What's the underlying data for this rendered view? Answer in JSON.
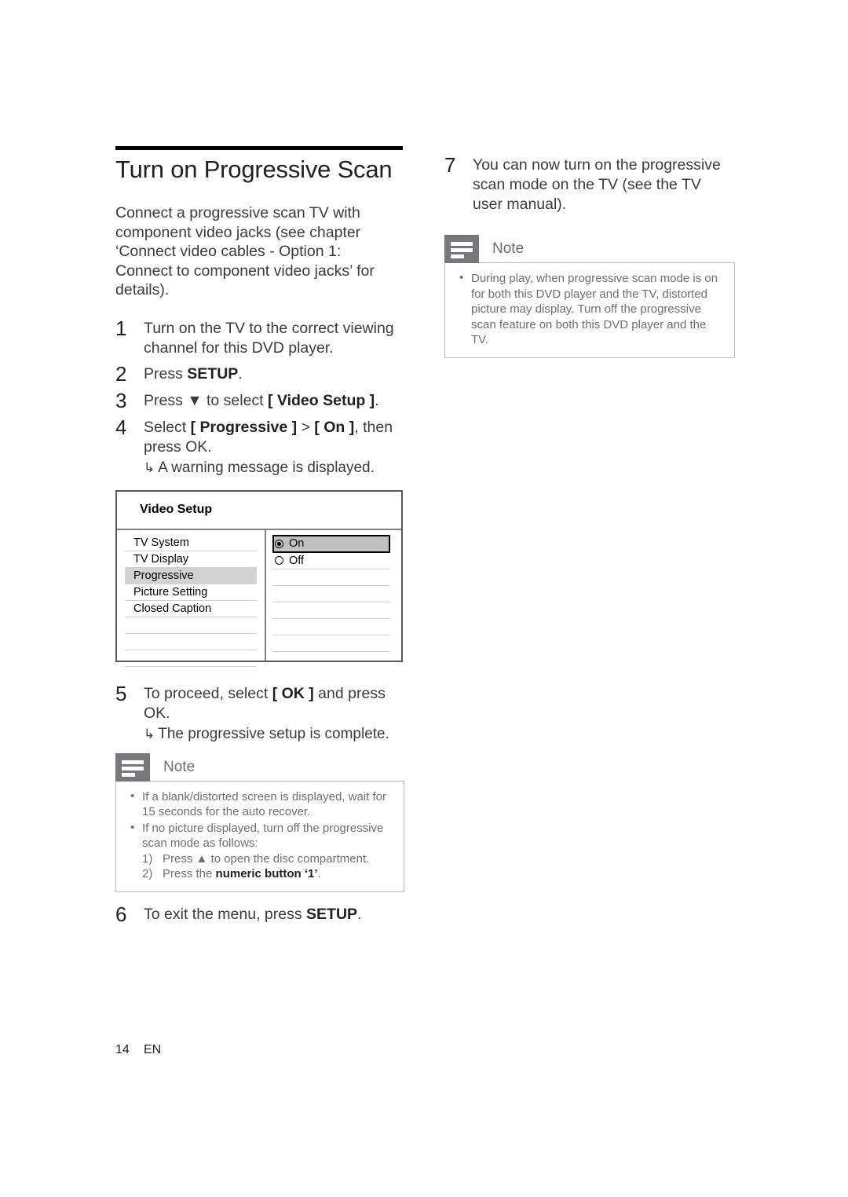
{
  "document": {
    "title": "Turn on Progressive Scan",
    "intro": "Connect a progressive scan TV with component video jacks (see chapter ‘Connect video cables - Option 1: Connect to component video jacks’ for details).",
    "footer": {
      "page_number": "14",
      "language": "EN"
    }
  },
  "steps": {
    "s1": {
      "num": "1",
      "text": "Turn on the TV to the correct viewing channel for this DVD player."
    },
    "s2": {
      "num": "2",
      "pre": "Press ",
      "bold": "SETUP",
      "post": "."
    },
    "s3": {
      "num": "3",
      "pre": "Press ▼ to select ",
      "bold": "[ Video Setup ]",
      "post": "."
    },
    "s4": {
      "num": "4",
      "pre": "Select ",
      "bold1": "[ Progressive ]",
      "mid": " > ",
      "bold2": "[ On ]",
      "post": ", then press OK.",
      "result": "A warning message is displayed.",
      "arrow": "↳"
    },
    "s5": {
      "num": "5",
      "pre": "To proceed, select ",
      "bold": "[ OK ]",
      "post": " and press OK.",
      "result": "The progressive setup is complete.",
      "arrow": "↳"
    },
    "s6": {
      "num": "6",
      "pre": "To exit the menu, press ",
      "bold": "SETUP",
      "post": "."
    },
    "s7": {
      "num": "7",
      "text": "You can now turn on the progressive scan mode on the TV (see the TV user manual)."
    }
  },
  "menu_screen": {
    "header": "Video Setup",
    "left_items": [
      {
        "label": "TV System",
        "selected": false
      },
      {
        "label": "TV Display",
        "selected": false
      },
      {
        "label": "Progressive",
        "selected": true
      },
      {
        "label": "Picture Setting",
        "selected": false
      },
      {
        "label": "Closed Caption",
        "selected": false
      }
    ],
    "left_empty_rows": 3,
    "right_items": [
      {
        "label": "On",
        "selected": true,
        "radio": "filled"
      },
      {
        "label": "Off",
        "selected": false,
        "radio": "empty"
      }
    ],
    "right_empty_rows": 6
  },
  "note_left": {
    "title": "Note",
    "icon": "note-lines-icon",
    "bullets": [
      "If a blank/distorted screen is displayed, wait for 15 seconds for the auto recover.",
      "If no picture displayed, turn off the progressive scan mode as follows:"
    ],
    "sub_items": [
      {
        "ord": "1)",
        "pre": "Press ▲ to open the disc compartment.",
        "bold": "",
        "post": ""
      },
      {
        "ord": "2)",
        "pre": "Press the ",
        "bold": "numeric button ‘1’",
        "post": "."
      }
    ]
  },
  "note_right": {
    "title": "Note",
    "icon": "note-lines-icon",
    "bullets": [
      "During play, when progressive scan mode is on for both this DVD player and the TV, distorted picture may display. Turn off the progressive scan feature on both this DVD player and the TV."
    ]
  },
  "colors": {
    "note_gray": "#77787b",
    "text_body": "#3b3b3b",
    "heading": "#231f20",
    "menu_border": "#58595b",
    "menu_selected": "#d3d3d3"
  }
}
